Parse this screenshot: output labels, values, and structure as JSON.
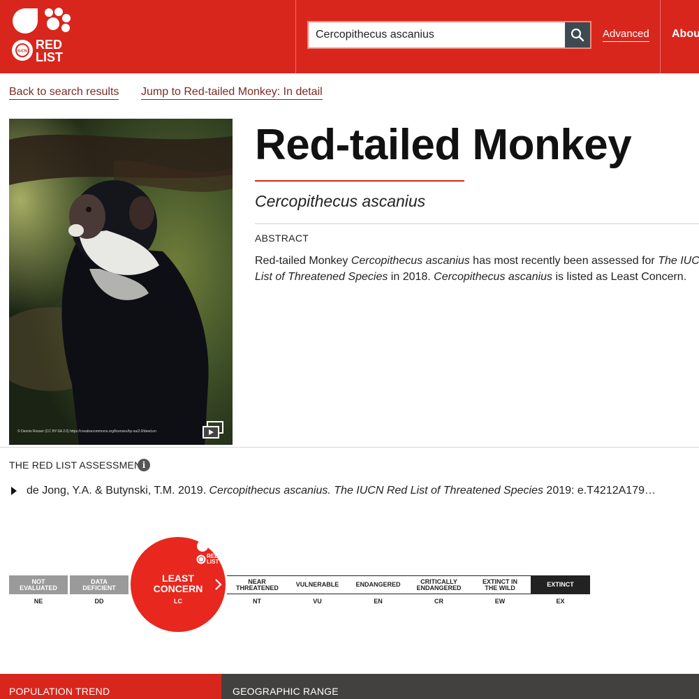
{
  "header": {
    "logo_text": "RED LIST",
    "logo_sub": "IUCN",
    "search_value": "Cercopithecus ascanius",
    "advanced_label": "Advanced",
    "about_label": "About"
  },
  "nav": {
    "back_label": "Back to search results",
    "jump_label": "Jump to Red-tailed Monkey: In detail"
  },
  "photo": {
    "credit": "© Dennis Rosser (CC BY-SA 2.0) https://creativecommons.org/licenses/by-sa/2.0/deed.en"
  },
  "species": {
    "common_name": "Red-tailed Monkey",
    "scientific_name": "Cercopithecus ascanius"
  },
  "abstract": {
    "label": "ABSTRACT",
    "part1": "Red-tailed Monkey ",
    "sci1": "Cercopithecus ascanius",
    "part2": " has most recently been assessed for ",
    "list_name": "The IUCN Red List of Threatened Species",
    "part3": " in 2018. ",
    "sci2": "Cercopithecus ascanius",
    "part4": " is listed as Least Concern."
  },
  "assessment": {
    "label": "THE RED LIST ASSESSMENT",
    "info": "i",
    "citation_authors": "de Jong, Y.A. & Butynski, T.M. 2019. ",
    "citation_sci": "Cercopithecus ascanius.",
    "citation_space": " ",
    "citation_journal": "The IUCN Red List of Threatened Species",
    "citation_rest": " 2019: e.T4212A179…"
  },
  "categories": {
    "ne": {
      "label": "NOT EVALUATED",
      "code": "NE"
    },
    "dd": {
      "label": "DATA DEFICIENT",
      "code": "DD"
    },
    "lc": {
      "label": "LEAST CONCERN",
      "code": "LC"
    },
    "nt": {
      "label": "NEAR THREATENED",
      "code": "NT"
    },
    "vu": {
      "label": "VULNERABLE",
      "code": "VU"
    },
    "en": {
      "label": "ENDANGERED",
      "code": "EN"
    },
    "cr": {
      "label": "CRITICALLY ENDANGERED",
      "code": "CR"
    },
    "ew": {
      "label": "EXTINCT IN THE WILD",
      "code": "EW"
    },
    "ex": {
      "label": "EXTINCT",
      "code": "EX"
    }
  },
  "colors": {
    "brand_red": "#d9261c",
    "dark_bar": "#434140"
  },
  "sections": {
    "population_trend": "POPULATION TREND",
    "geographic_range": "GEOGRAPHIC RANGE"
  }
}
